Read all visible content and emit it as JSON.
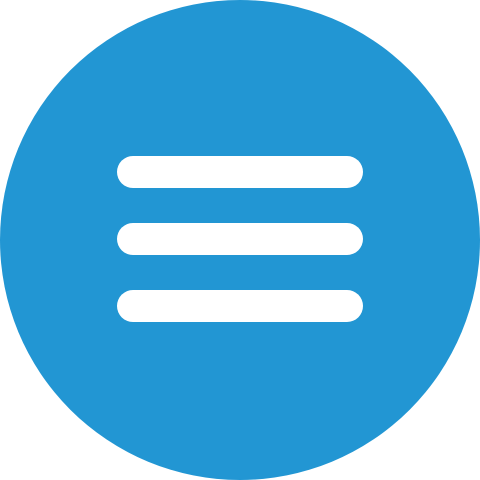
{
  "menu_button": {
    "icon": "hamburger-menu-icon",
    "background_color": "#2296d3",
    "bar_color": "#ffffff",
    "bar_count": 3
  }
}
